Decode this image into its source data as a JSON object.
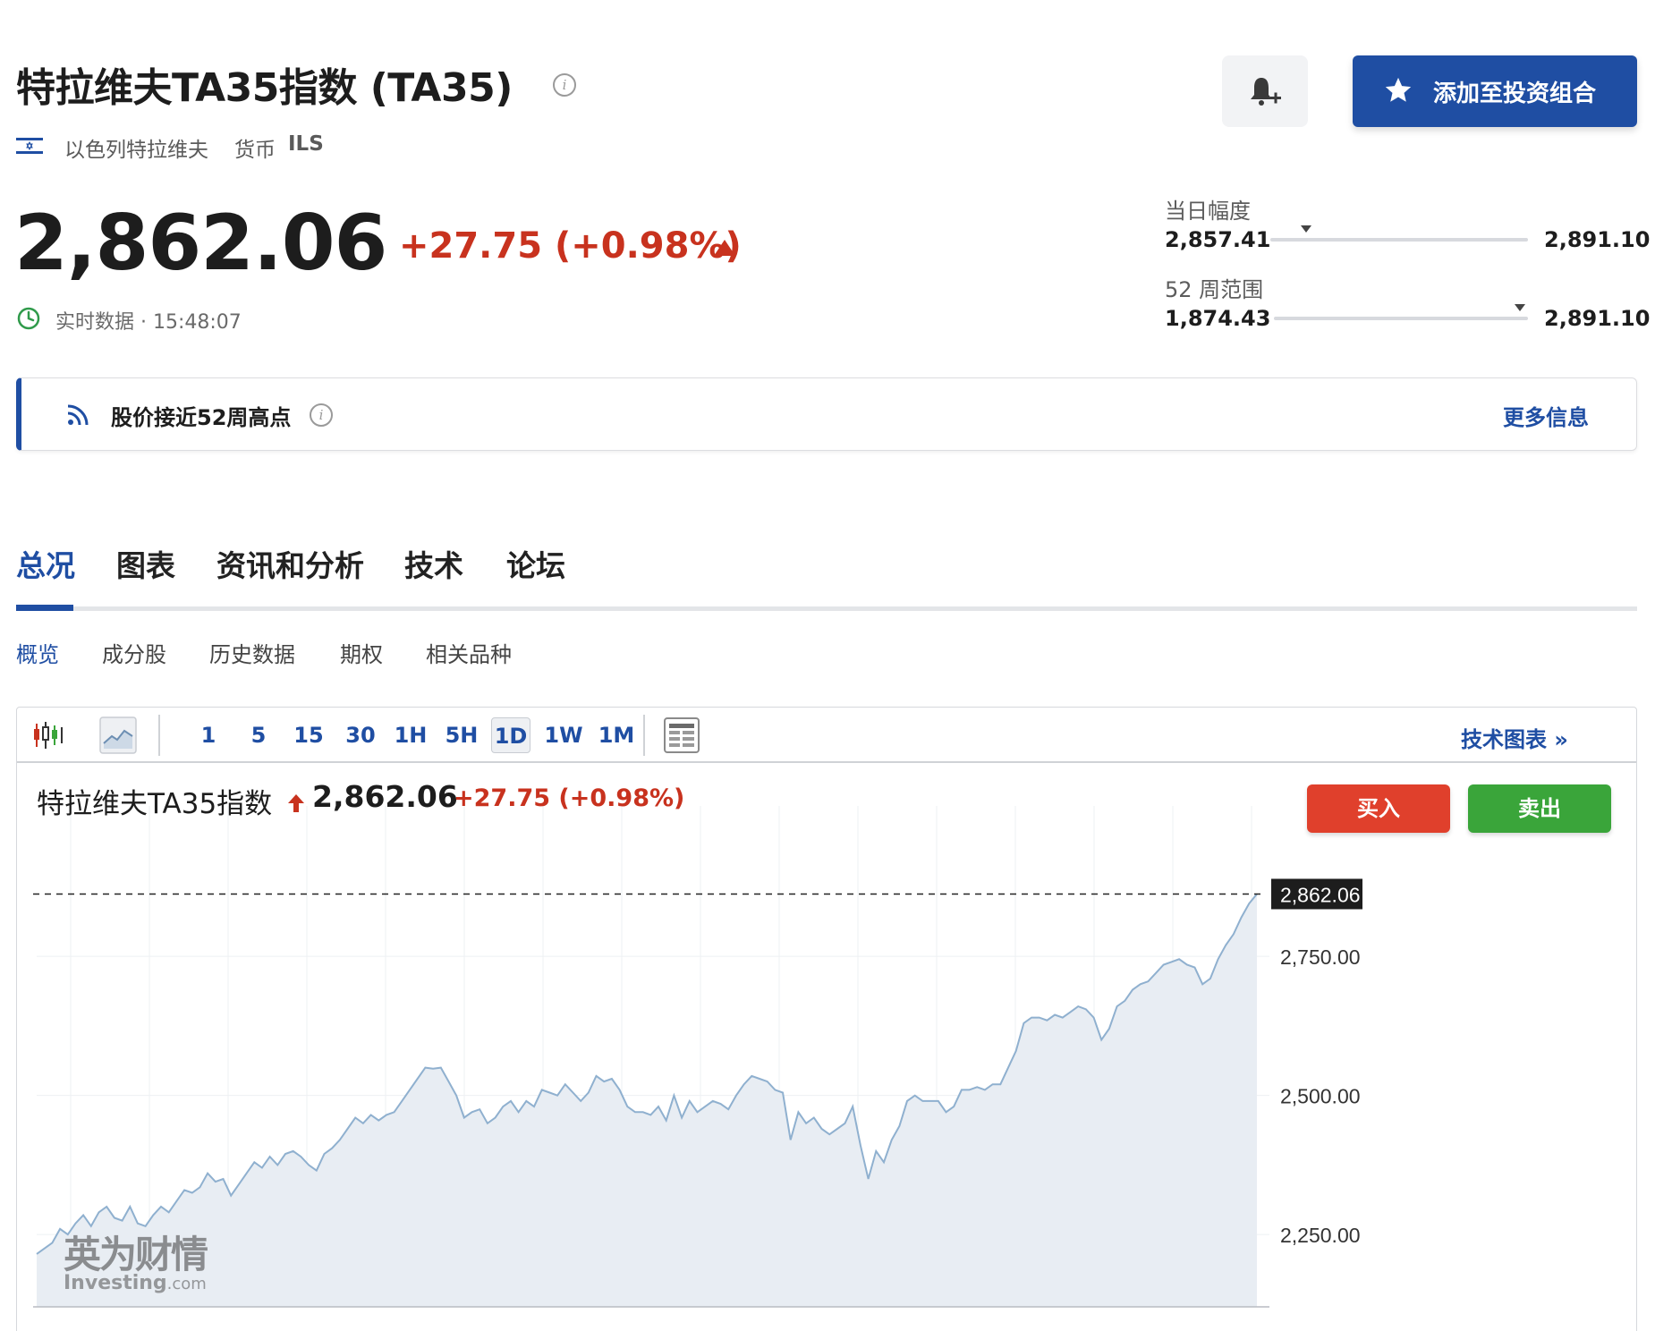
{
  "header": {
    "title": "特拉维夫TA35指数 (TA35)",
    "exchange": "以色列特拉维夫",
    "currency_label": "货币",
    "currency_value": "ILS",
    "portfolio_button": "添加至投资组合"
  },
  "quote": {
    "price": "2,862.06",
    "change": "+27.75 (+0.98%)",
    "realtime_label": "实时数据 · 15:48:07"
  },
  "ranges": {
    "day": {
      "label": "当日幅度",
      "low": "2,857.41",
      "high": "2,891.10",
      "position": 0.14
    },
    "week52": {
      "label": "52 周范围",
      "low": "1,874.43",
      "high": "2,891.10",
      "position": 0.97
    }
  },
  "alert": {
    "text": "股价接近52周高点",
    "more": "更多信息"
  },
  "tabs": [
    "总况",
    "图表",
    "资讯和分析",
    "技术",
    "论坛"
  ],
  "subtabs": [
    "概览",
    "成分股",
    "历史数据",
    "期权",
    "相关品种"
  ],
  "chart_toolbar": {
    "timeframes": [
      "1",
      "5",
      "15",
      "30",
      "1H",
      "5H",
      "1D",
      "1W",
      "1M"
    ],
    "active_timeframe": "1D",
    "tech_chart_link": "技术图表 »"
  },
  "chart_legend": {
    "name": "特拉维夫TA35指数",
    "price": "2,862.06",
    "change": "+27.75 (+0.98%)"
  },
  "trade": {
    "buy": "买入",
    "sell": "卖出"
  },
  "watermark": {
    "cn": "英为财情",
    "en": "Investing",
    "en_suffix": ".com"
  },
  "colors": {
    "brand_blue": "#1f4ea3",
    "up_red": "#c8321e",
    "buy_red": "#e0402c",
    "sell_green": "#3aa53a",
    "line": "#8fb0cf",
    "area": "#e8edf3"
  },
  "chart_data": {
    "type": "area",
    "ylim": [
      2120,
      2940
    ],
    "yticks": [
      2250,
      2500,
      2750
    ],
    "ytick_labels": [
      "2,250.00",
      "2,500.00",
      "2,750.00"
    ],
    "last_value": 2862.06,
    "last_label": "2,862.06",
    "grid": true,
    "values": [
      2215,
      2225,
      2235,
      2260,
      2250,
      2270,
      2285,
      2265,
      2290,
      2300,
      2280,
      2275,
      2300,
      2270,
      2265,
      2285,
      2300,
      2290,
      2310,
      2330,
      2325,
      2335,
      2360,
      2345,
      2350,
      2320,
      2340,
      2360,
      2380,
      2370,
      2390,
      2375,
      2395,
      2400,
      2390,
      2375,
      2365,
      2395,
      2405,
      2420,
      2440,
      2460,
      2450,
      2465,
      2455,
      2465,
      2470,
      2490,
      2510,
      2530,
      2550,
      2548,
      2550,
      2525,
      2500,
      2460,
      2470,
      2475,
      2450,
      2460,
      2480,
      2490,
      2470,
      2490,
      2480,
      2510,
      2505,
      2500,
      2520,
      2505,
      2490,
      2505,
      2535,
      2525,
      2530,
      2510,
      2480,
      2470,
      2470,
      2465,
      2480,
      2455,
      2500,
      2460,
      2490,
      2470,
      2480,
      2490,
      2485,
      2475,
      2500,
      2520,
      2535,
      2530,
      2525,
      2510,
      2505,
      2420,
      2470,
      2450,
      2460,
      2440,
      2430,
      2440,
      2450,
      2480,
      2410,
      2350,
      2400,
      2380,
      2420,
      2445,
      2490,
      2500,
      2490,
      2490,
      2490,
      2470,
      2480,
      2510,
      2510,
      2515,
      2510,
      2520,
      2520,
      2550,
      2580,
      2630,
      2640,
      2640,
      2635,
      2645,
      2640,
      2650,
      2660,
      2655,
      2640,
      2600,
      2620,
      2660,
      2670,
      2690,
      2700,
      2705,
      2720,
      2735,
      2740,
      2745,
      2735,
      2730,
      2700,
      2710,
      2745,
      2770,
      2790,
      2820,
      2845,
      2862.06
    ]
  }
}
